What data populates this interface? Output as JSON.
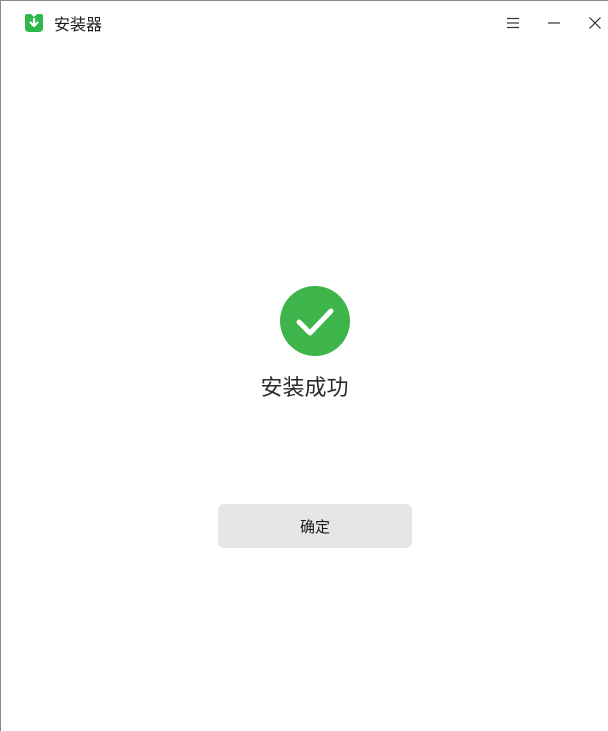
{
  "window": {
    "title": "安装器",
    "icon": "installer-app-icon",
    "controls": {
      "menu_icon": "menu-icon",
      "minimize_icon": "minimize-icon",
      "close_icon": "close-icon"
    }
  },
  "main": {
    "status_icon": "success-check-icon",
    "status_text": "安装成功",
    "confirm_label": "确定"
  },
  "colors": {
    "success_green": "#3db54a",
    "app_icon_green": "#2fb84c",
    "button_bg": "#e6e6e6"
  }
}
